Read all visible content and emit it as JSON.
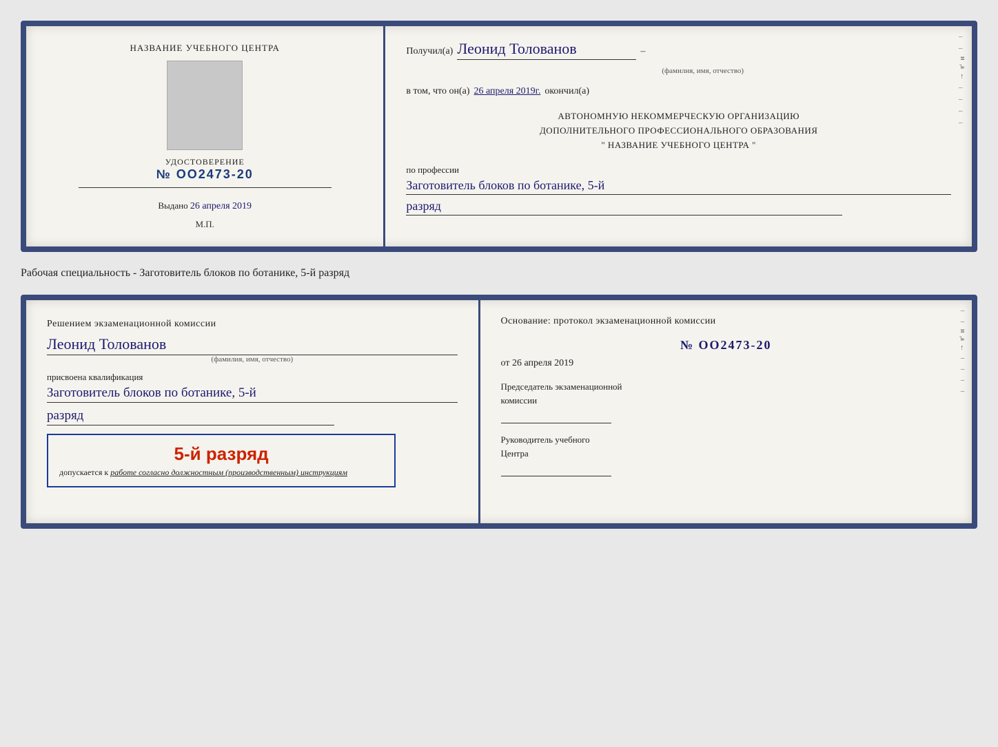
{
  "cert1": {
    "left": {
      "title": "НАЗВАНИЕ УЧЕБНОГО ЦЕНТРА",
      "cert_label": "УДОСТОВЕРЕНИЕ",
      "cert_number_prefix": "№",
      "cert_number": "OO2473-20",
      "issued_label": "Выдано",
      "issued_date": "26 апреля 2019",
      "mp_label": "М.П."
    },
    "right": {
      "recipient_prefix": "Получил(а)",
      "recipient_name": "Леонид Толованов",
      "recipient_subtext": "(фамилия, имя, отчество)",
      "fact_prefix": "в том, что он(а)",
      "fact_date": "26 апреля 2019г.",
      "fact_suffix": "окончил(а)",
      "org_line1": "АВТОНОМНУЮ НЕКОММЕРЧЕСКУЮ ОРГАНИЗАЦИЮ",
      "org_line2": "ДОПОЛНИТЕЛЬНОГО ПРОФЕССИОНАЛЬНОГО ОБРАЗОВАНИЯ",
      "org_line3": "\"  НАЗВАНИЕ УЧЕБНОГО ЦЕНТРА  \"",
      "profession_label": "по профессии",
      "profession_value": "Заготовитель блоков по ботанике, 5-й",
      "razryad_value": "разряд"
    }
  },
  "specialty_text": "Рабочая специальность - Заготовитель блоков по ботанике, 5-й разряд",
  "cert2": {
    "left": {
      "decision_text": "Решением экзаменационной комиссии",
      "person_name": "Леонид Толованов",
      "person_subtext": "(фамилия, имя, отчество)",
      "qualification_label": "присвоена квалификация",
      "profession_value": "Заготовитель блоков по ботанике, 5-й",
      "razryad_value": "разряд",
      "badge_rank": "5-й разряд",
      "badge_allowed_prefix": "допускается к",
      "badge_allowed_italic": "работе согласно должностным (производственным) инструкциям"
    },
    "right": {
      "basis_label": "Основание: протокол экзаменационной комиссии",
      "protocol_number": "№  OO2473-20",
      "date_prefix": "от",
      "date_value": "26 апреля 2019",
      "chairman_label_line1": "Председатель экзаменационной",
      "chairman_label_line2": "комиссии",
      "head_label_line1": "Руководитель учебного",
      "head_label_line2": "Центра"
    }
  }
}
